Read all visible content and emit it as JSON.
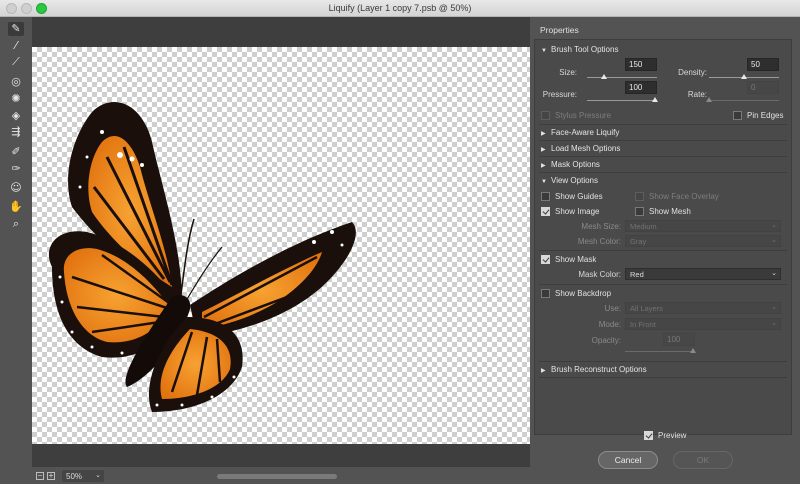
{
  "window": {
    "title": "Liquify (Layer 1 copy 7.psb @ 50%)"
  },
  "tools": [
    {
      "name": "forward-warp-tool-icon",
      "glyph": "✎"
    },
    {
      "name": "reconstruct-tool-icon",
      "glyph": "⁄"
    },
    {
      "name": "smooth-tool-icon",
      "glyph": "⟋"
    },
    {
      "name": "twirl-tool-icon",
      "glyph": "◎"
    },
    {
      "name": "pucker-tool-icon",
      "glyph": "✺"
    },
    {
      "name": "bloat-tool-icon",
      "glyph": "◈"
    },
    {
      "name": "push-left-tool-icon",
      "glyph": "⇶"
    },
    {
      "name": "freeze-mask-tool-icon",
      "glyph": "✐"
    },
    {
      "name": "thaw-mask-tool-icon",
      "glyph": "✑"
    },
    {
      "name": "face-tool-icon",
      "glyph": "☺"
    },
    {
      "name": "hand-tool-icon",
      "glyph": "✋"
    },
    {
      "name": "zoom-tool-icon",
      "glyph": "⌕"
    }
  ],
  "status": {
    "zoom_out": "−",
    "zoom_in": "+",
    "zoom_value": "50%"
  },
  "properties": {
    "title": "Properties",
    "brush": {
      "header": "Brush Tool Options",
      "size_label": "Size:",
      "size_value": "150",
      "density_label": "Density:",
      "density_value": "50",
      "pressure_label": "Pressure:",
      "pressure_value": "100",
      "rate_label": "Rate:",
      "rate_value": "0",
      "stylus_label": "Stylus Pressure",
      "pin_edges_label": "Pin Edges"
    },
    "face_aware": "Face-Aware Liquify",
    "load_mesh": "Load Mesh Options",
    "mask_options": "Mask Options",
    "view": {
      "header": "View Options",
      "show_guides": "Show Guides",
      "show_face_overlay": "Show Face Overlay",
      "show_image": "Show Image",
      "show_mesh": "Show Mesh",
      "mesh_size_label": "Mesh Size:",
      "mesh_size_value": "Medium",
      "mesh_color_label": "Mesh Color:",
      "mesh_color_value": "Gray",
      "show_mask": "Show Mask",
      "mask_color_label": "Mask Color:",
      "mask_color_value": "Red",
      "show_backdrop": "Show Backdrop",
      "use_label": "Use:",
      "use_value": "All Layers",
      "mode_label": "Mode:",
      "mode_value": "In Front",
      "opacity_label": "Opacity:",
      "opacity_value": "100"
    },
    "brush_reconstruct": "Brush Reconstruct Options",
    "preview_label": "Preview",
    "cancel": "Cancel",
    "ok": "OK"
  },
  "colors": {
    "panel": "#535353",
    "accent_orange": "#f08a1c",
    "wing_border": "#1a0f0a"
  }
}
